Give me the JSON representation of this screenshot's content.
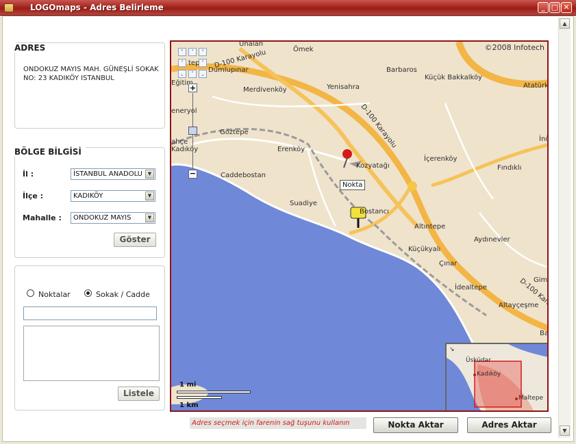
{
  "window": {
    "title": "LOGOmaps - Adres Belirleme",
    "min_glyph": "_",
    "max_glyph": "□",
    "close_glyph": "✕"
  },
  "address_panel": {
    "heading": "ADRES",
    "line1": "ONDOKUZ MAYIS MAH. GÜNEŞLİ SOKAK",
    "line2": "NO: 23 KADIKÖY ISTANBUL"
  },
  "region_panel": {
    "heading": "BÖLGE BİLGİSİ",
    "il_label": "İl :",
    "il_value": "İSTANBUL ANADOLU",
    "ilce_label": "İlçe :",
    "ilce_value": "KADIKÖY",
    "mahalle_label": "Mahalle :",
    "mahalle_value": "ONDOKUZ MAYIS",
    "show_button": "Göster"
  },
  "search_panel": {
    "radio_points": "Noktalar",
    "radio_street": "Sokak / Cadde",
    "selected": "Sokak / Cadde",
    "search_value": "",
    "list_button": "Listele"
  },
  "footer": {
    "hint": "Adres seçmek için farenin sağ tuşunu kullanın",
    "point_export_button": "Nokta Aktar",
    "address_export_button": "Adres Aktar"
  },
  "map": {
    "copyright": "©2008 Infotech",
    "marker_label": "Nokta",
    "scale_mi": "1 mi",
    "scale_km": "1 km",
    "places": [
      {
        "name": "Unalan"
      },
      {
        "name": "Ömek"
      },
      {
        "name": "D-100 Karayolu"
      },
      {
        "name": "Dumlupınar"
      },
      {
        "name": "Barbaros"
      },
      {
        "name": "Küçük Bakkalköy"
      },
      {
        "name": "Eğitim"
      },
      {
        "name": "Yenisahra"
      },
      {
        "name": "Merdivenköy"
      },
      {
        "name": "Atatürk"
      },
      {
        "name": "D-100 Karayolu"
      },
      {
        "name": "Göztepe"
      },
      {
        "name": "Erenköy"
      },
      {
        "name": "Kozyatağı"
      },
      {
        "name": "İçerenköy"
      },
      {
        "name": "Fındıklı"
      },
      {
        "name": "İnö"
      },
      {
        "name": "Caddebostan"
      },
      {
        "name": "Suadiye"
      },
      {
        "name": "Bostancı"
      },
      {
        "name": "Altıntepe"
      },
      {
        "name": "Aydınevler"
      },
      {
        "name": "Küçükyalı"
      },
      {
        "name": "Çınar"
      },
      {
        "name": "Gim"
      },
      {
        "name": "İdealtepe"
      },
      {
        "name": "D-100 Karay"
      },
      {
        "name": "Altayçeşme"
      },
      {
        "name": "Bas"
      },
      {
        "name": "eneryol"
      },
      {
        "name": "Kadıköy"
      },
      {
        "name": "ahçe"
      },
      {
        "name": "tepe"
      }
    ],
    "overview_places": [
      {
        "name": "Üsküdar"
      },
      {
        "name": "Kadıköy"
      },
      {
        "name": "Maltepe"
      }
    ]
  },
  "colors": {
    "titlebar": "#a52821",
    "map_border": "#8e1414",
    "sea": "#6f88d8",
    "land": "#efe3cc",
    "hint_text": "#d31a1a"
  }
}
